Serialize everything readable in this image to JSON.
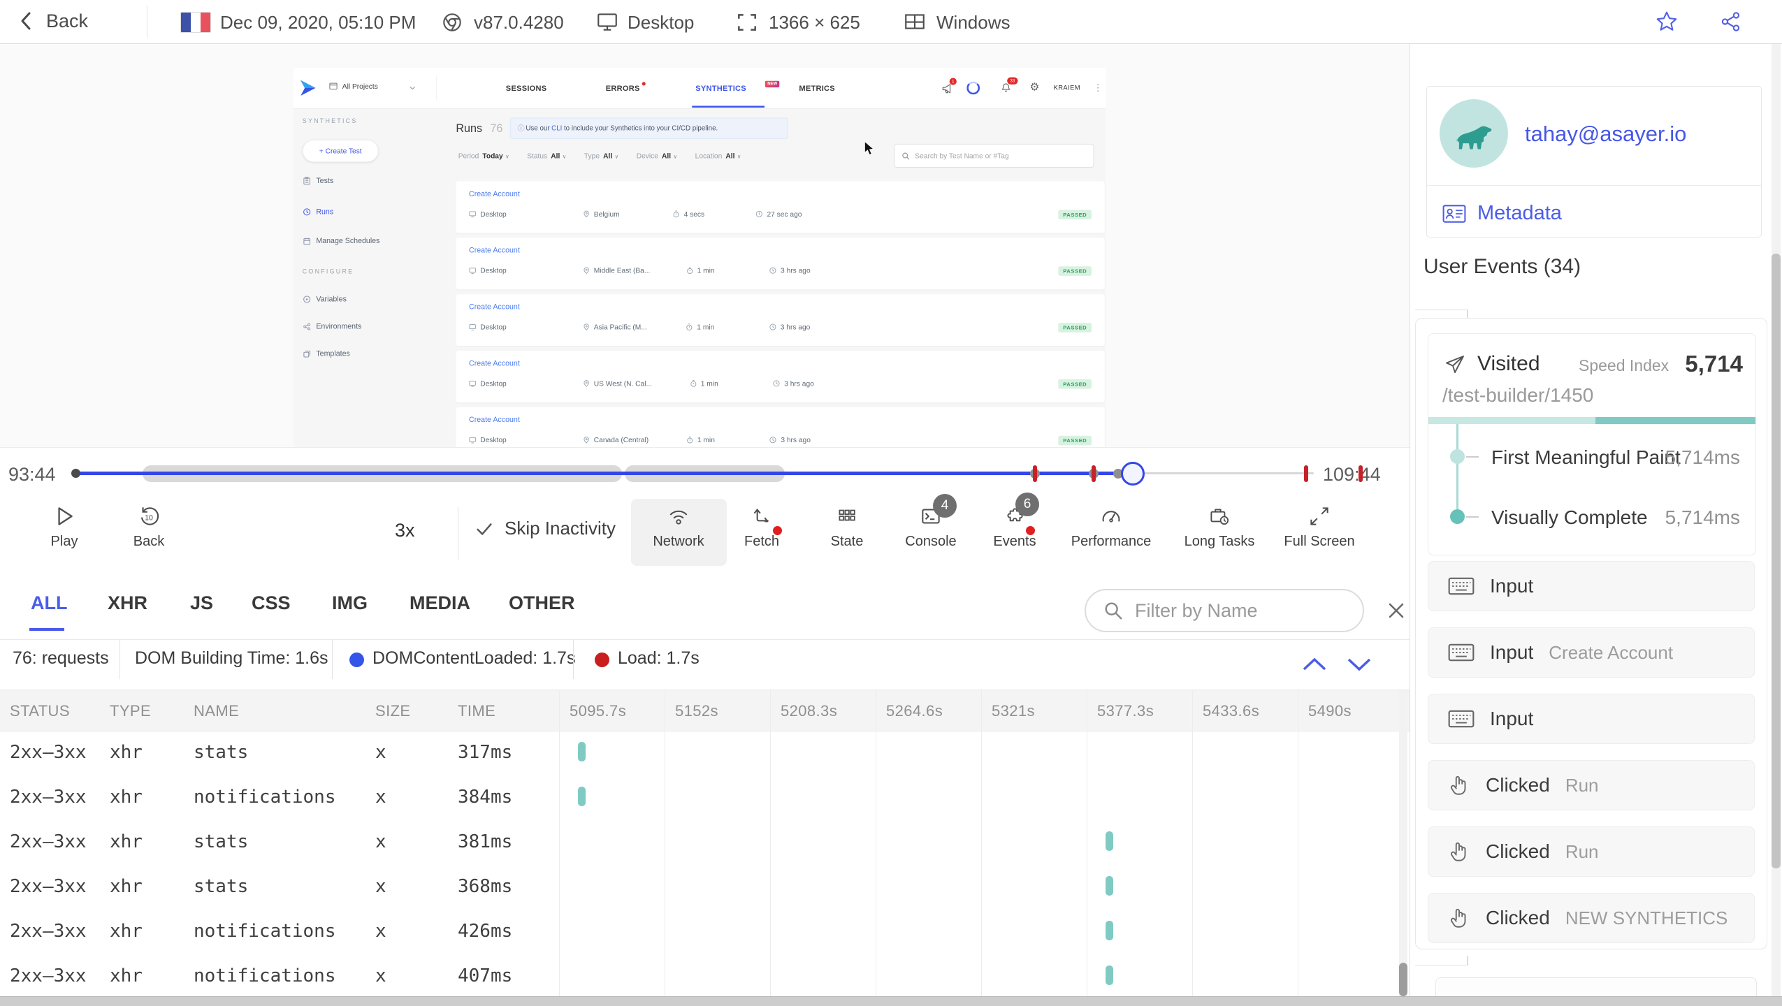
{
  "colors": {
    "accent": "#4a5ce8",
    "app_blue": "#3d55e8",
    "timeline_blue": "#3546ea",
    "teal": "#7fcbc4",
    "teal_light": "#c7e7e3",
    "red": "#c62128",
    "badge_red": "#e02b2b",
    "green_text": "#27a35b",
    "green_bg": "#d8f2e1"
  },
  "top_bar": {
    "back_label": "Back",
    "date": "Dec 09, 2020, 05:10 PM",
    "browser_version": "v87.0.4280",
    "device": "Desktop",
    "resolution": "1366 × 625",
    "os": "Windows"
  },
  "replay_app": {
    "navbar": {
      "project_selector": "All Projects",
      "tabs": [
        "SESSIONS",
        "ERRORS",
        "SYNTHETICS",
        "METRICS"
      ],
      "new_badge": "NEW",
      "announce_badge": "1",
      "bell_badge": "33",
      "user": "KRAIEM"
    },
    "sidebar": {
      "section1": "SYNTHETICS",
      "create_test": "+ Create Test",
      "items1": [
        "Tests",
        "Runs",
        "Manage Schedules"
      ],
      "section2": "CONFIGURE",
      "items2": [
        "Variables",
        "Environments",
        "Templates"
      ]
    },
    "main": {
      "title": "Runs",
      "count": "76",
      "banner_icon": "ⓘ",
      "banner_pre": " Use our ",
      "banner_link": "CLI",
      "banner_post": " to include your Synthetics into your CI/CD pipeline.",
      "filters": [
        {
          "label": "Period",
          "value": "Today"
        },
        {
          "label": "Status",
          "value": "All"
        },
        {
          "label": "Type",
          "value": "All"
        },
        {
          "label": "Device",
          "value": "All"
        },
        {
          "label": "Location",
          "value": "All"
        }
      ],
      "search_placeholder": "Search by Test Name or #Tag",
      "runs": [
        {
          "name": "Create Account",
          "device": "Desktop",
          "location": "Belgium",
          "duration": "4 secs",
          "ago": "27 sec ago",
          "status": "PASSED"
        },
        {
          "name": "Create Account",
          "device": "Desktop",
          "location": "Middle East (Ba...",
          "duration": "1 min",
          "ago": "3 hrs ago",
          "status": "PASSED"
        },
        {
          "name": "Create Account",
          "device": "Desktop",
          "location": "Asia Pacific (M...",
          "duration": "1 min",
          "ago": "3 hrs ago",
          "status": "PASSED"
        },
        {
          "name": "Create Account",
          "device": "Desktop",
          "location": "US West (N. Cal...",
          "duration": "1 min",
          "ago": "3 hrs ago",
          "status": "PASSED"
        },
        {
          "name": "Create Account",
          "device": "Desktop",
          "location": "Canada (Central)",
          "duration": "1 min",
          "ago": "3 hrs ago",
          "status": "PASSED"
        }
      ]
    }
  },
  "timeline": {
    "current": "93:44",
    "total": "109:44"
  },
  "controls": {
    "play": "Play",
    "back": "Back",
    "back_seconds": "10",
    "speed": "3x",
    "skip": "Skip Inactivity",
    "buttons": [
      {
        "label": "Network"
      },
      {
        "label": "Fetch"
      },
      {
        "label": "State"
      },
      {
        "label": "Console",
        "badge": "4"
      },
      {
        "label": "Events",
        "badge": "6"
      },
      {
        "label": "Performance"
      },
      {
        "label": "Long Tasks"
      },
      {
        "label": "Full Screen"
      }
    ]
  },
  "network": {
    "tabs": [
      "ALL",
      "XHR",
      "JS",
      "CSS",
      "IMG",
      "MEDIA",
      "OTHER"
    ],
    "filter_placeholder": "Filter by Name",
    "summary": {
      "requests": "76: requests",
      "dom_building": "DOM Building Time: 1.6s",
      "dom_content_loaded": "DOMContentLoaded: 1.7s",
      "load": "Load: 1.7s"
    },
    "columns": [
      "STATUS",
      "TYPE",
      "NAME",
      "SIZE",
      "TIME"
    ],
    "time_columns": [
      "5095.7s",
      "5152s",
      "5208.3s",
      "5264.6s",
      "5321s",
      "5377.3s",
      "5433.6s",
      "5490s"
    ],
    "rows": [
      {
        "status": "2xx–3xx",
        "type": "xhr",
        "name": "stats",
        "size": "x",
        "time": "317ms",
        "bar_col": 0
      },
      {
        "status": "2xx–3xx",
        "type": "xhr",
        "name": "notifications",
        "size": "x",
        "time": "384ms",
        "bar_col": 0
      },
      {
        "status": "2xx–3xx",
        "type": "xhr",
        "name": "stats",
        "size": "x",
        "time": "381ms",
        "bar_col": 5
      },
      {
        "status": "2xx–3xx",
        "type": "xhr",
        "name": "stats",
        "size": "x",
        "time": "368ms",
        "bar_col": 5
      },
      {
        "status": "2xx–3xx",
        "type": "xhr",
        "name": "notifications",
        "size": "x",
        "time": "426ms",
        "bar_col": 5
      },
      {
        "status": "2xx–3xx",
        "type": "xhr",
        "name": "notifications",
        "size": "x",
        "time": "407ms",
        "bar_col": 5
      }
    ]
  },
  "user_panel": {
    "email": "tahay@asayer.io",
    "metadata_label": "Metadata",
    "events_title": "User Events (34)",
    "visited": {
      "label": "Visited",
      "speed_index_label": "Speed Index",
      "speed_index": "5,714",
      "url": "/test-builder/1450",
      "metrics": [
        {
          "name": "First Meaningful Paint",
          "value": "5,714ms"
        },
        {
          "name": "Visually Complete",
          "value": "5,714ms"
        }
      ]
    },
    "events": [
      {
        "label": "Input",
        "value": ""
      },
      {
        "label": "Input",
        "value": "Create Account"
      },
      {
        "label": "Input",
        "value": ""
      },
      {
        "label": "Clicked",
        "value": "Run"
      },
      {
        "label": "Clicked",
        "value": "Run"
      },
      {
        "label": "Clicked",
        "value": "NEW SYNTHETICS"
      }
    ]
  }
}
